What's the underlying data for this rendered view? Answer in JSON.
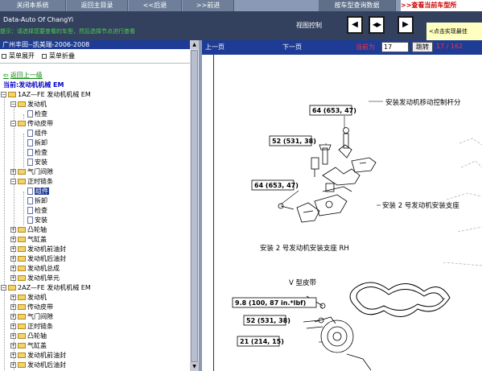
{
  "toolbar": {
    "close_label": "关闭本系统",
    "home_label": "返回主目录",
    "back_label": "<<后退",
    "forward_label": ">>前进",
    "query_label": "按车型查询数据",
    "top_link": ">>查看当前车型所"
  },
  "header": {
    "app_title": "Data-Auto Of ChangYi",
    "hint": "提示：请选择您要查看的车型，然后选择节点进行查看",
    "view_label": "视图控制",
    "best_hint": "<点击实现最佳"
  },
  "left": {
    "vehicle": "广州丰田--凯美瑞-2006-2008",
    "expand_label": "菜单展开",
    "collapse_label": "菜单折叠",
    "back_up": "返回上一级",
    "current_prefix": "当前:",
    "current": "发动机机械 EM"
  },
  "tree": [
    {
      "label": "1AZ—FE 发动机机械 EM",
      "type": "folder",
      "pm": "−"
    },
    {
      "label": "发动机",
      "type": "folder",
      "pm": "−"
    },
    {
      "label": "检查",
      "type": "doc"
    },
    {
      "label": "传动皮带",
      "type": "folder",
      "pm": "−"
    },
    {
      "label": "组件",
      "type": "doc"
    },
    {
      "label": "拆卸",
      "type": "doc"
    },
    {
      "label": "检查",
      "type": "doc"
    },
    {
      "label": "安装",
      "type": "doc"
    },
    {
      "label": "气门间隙",
      "type": "folder",
      "pm": "+"
    },
    {
      "label": "正时链条",
      "type": "folder",
      "pm": "−"
    },
    {
      "label": "组件",
      "type": "doc",
      "selected": true
    },
    {
      "label": "拆卸",
      "type": "doc"
    },
    {
      "label": "检查",
      "type": "doc"
    },
    {
      "label": "安装",
      "type": "doc"
    },
    {
      "label": "凸轮轴",
      "type": "folder",
      "pm": "+"
    },
    {
      "label": "气缸盖",
      "type": "folder",
      "pm": "+"
    },
    {
      "label": "发动机前油封",
      "type": "folder",
      "pm": "+"
    },
    {
      "label": "发动机后油封",
      "type": "folder",
      "pm": "+"
    },
    {
      "label": "发动机总成",
      "type": "folder",
      "pm": "+"
    },
    {
      "label": "发动机单元",
      "type": "folder",
      "pm": "+"
    },
    {
      "label": "2AZ—FE 发动机机械 EM",
      "type": "folder",
      "pm": "−"
    },
    {
      "label": "发动机",
      "type": "folder",
      "pm": "+"
    },
    {
      "label": "传动皮带",
      "type": "folder",
      "pm": "+"
    },
    {
      "label": "气门间隙",
      "type": "folder",
      "pm": "+"
    },
    {
      "label": "正时链条",
      "type": "folder",
      "pm": "+"
    },
    {
      "label": "凸轮轴",
      "type": "folder",
      "pm": "+"
    },
    {
      "label": "气缸盖",
      "type": "folder",
      "pm": "+"
    },
    {
      "label": "发动机前油封",
      "type": "folder",
      "pm": "+"
    },
    {
      "label": "发动机后油封",
      "type": "folder",
      "pm": "+"
    }
  ],
  "nav": {
    "prev_label": "上一页",
    "next_label": "下一页",
    "current_label": "当前为",
    "page_value": "17",
    "jump_label": "跳转",
    "page_count": "17 / 162"
  },
  "diagram": {
    "torque_1": "64 (653, 47)",
    "torque_2": "52 (531, 38)",
    "torque_3": "64 (653, 47)",
    "torque_4": "9.8 (100, 87 in.*lbf)",
    "torque_5": "52 (531, 38)",
    "torque_6": "21 (214, 15)",
    "label_control_rod": "安装发动机移动控制杆分",
    "label_mount_2": "安装 2 号发动机安装支座",
    "label_mount_rh": "安装 2 号发动机安装支座 RH",
    "label_vbelt": "V 型皮带"
  }
}
